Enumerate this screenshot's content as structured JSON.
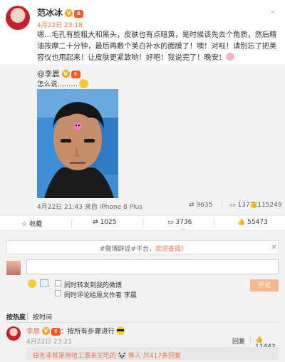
{
  "post": {
    "author": "范冰冰",
    "v_badge": "V",
    "level_badge": "6",
    "timestamp": "4月22日 23:18",
    "text": "嗯…毛孔有些粗大和黑头，皮肤也有点暗黄，是时候该先去个角质，然后精油按摩二十分钟，最后再敷个美白补水的面膜了！噢！对啦！请别忘了把美容仪也用起来！让皮肤更紧致哟！好吧！我说完了！晚安！"
  },
  "repost": {
    "user": "@李晨",
    "text": "怎么说………",
    "meta": "4月22日 21:43 来自 iPhone 8 Plus",
    "reposts": "9635",
    "comments": "13771",
    "likes": "115249"
  },
  "actions": {
    "favorite": "收藏",
    "repost": "1025",
    "comment": "3736",
    "like": "55473"
  },
  "comment_panel": {
    "notice_prefix": "#微博辟谣#平台，",
    "notice_link": "欢迎查阅！",
    "input_value": "",
    "check_repost": "同时转发到我的微博",
    "check_comment_origin": "同时评论给原文作者",
    "origin_author": "李晨",
    "submit": "评论",
    "sort_hot": "按热度",
    "sort_time": "按时间"
  },
  "comments": [
    {
      "user": "李晨",
      "text": "：按所有步骤进行",
      "time": "4月22日 23:21",
      "reply": "回复",
      "likes": "11442",
      "sub_reply": "钱无非就是用哈工源来买吃的 🐼 等人 共417条回复"
    }
  ],
  "colors": {
    "accent": "#eb7350",
    "timestamp": "#ee7d32",
    "panel_bg": "#f2f2f2",
    "submit_bg": "#f9b58e"
  }
}
